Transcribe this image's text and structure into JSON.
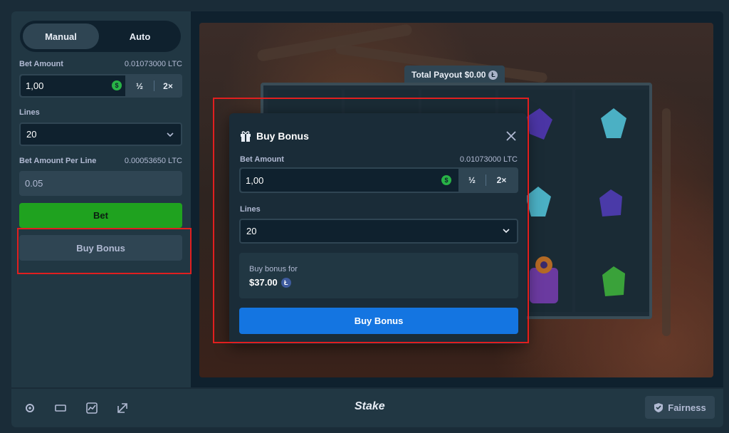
{
  "sidebar": {
    "tabs": [
      {
        "label": "Manual",
        "active": true
      },
      {
        "label": "Auto",
        "active": false
      }
    ],
    "bet_amount_label": "Bet Amount",
    "bet_amount_crypto": "0.01073000 LTC",
    "bet_amount_value": "1,00",
    "half_label": "½",
    "double_label": "2×",
    "lines_label": "Lines",
    "lines_value": "20",
    "per_line_label": "Bet Amount Per Line",
    "per_line_crypto": "0.00053650 LTC",
    "per_line_value": "0.05",
    "bet_button": "Bet",
    "buy_bonus_button": "Buy Bonus"
  },
  "game": {
    "total_payout": "Total Payout $0.00"
  },
  "modal": {
    "title": "Buy Bonus",
    "bet_amount_label": "Bet Amount",
    "bet_amount_crypto": "0.01073000 LTC",
    "bet_amount_value": "1,00",
    "half_label": "½",
    "double_label": "2×",
    "lines_label": "Lines",
    "lines_value": "20",
    "info_label": "Buy bonus for",
    "info_value": "$37.00",
    "buy_button": "Buy Bonus"
  },
  "bottom_bar": {
    "logo": "Stake",
    "fairness_label": "Fairness"
  },
  "colors": {
    "accent_blue": "#1475e1",
    "bet_green": "#1fa21f",
    "highlight_red": "#e11f1f"
  }
}
